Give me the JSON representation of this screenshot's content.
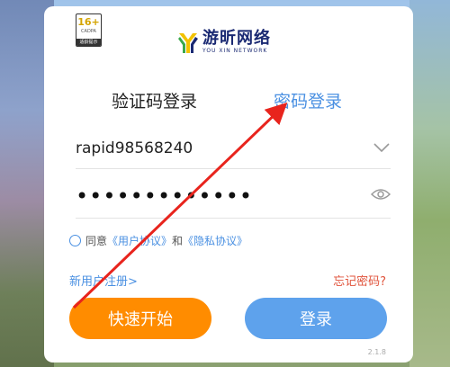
{
  "age_badge": {
    "age": "16+",
    "cadpa": "CADPA",
    "tip": "适龄提示"
  },
  "logo": {
    "name_cn": "游昕网络",
    "name_en": "YOU XIN NETWORK"
  },
  "tabs": {
    "sms_login": "验证码登录",
    "password_login": "密码登录"
  },
  "form": {
    "username": "rapid98568240",
    "password_masked": "•••••••••••••"
  },
  "agreement": {
    "prefix": "同意",
    "user_agreement": "《用户协议》",
    "and": "和",
    "privacy_policy": "《隐私协议》"
  },
  "links": {
    "register": "新用户注册>",
    "forgot": "忘记密码?"
  },
  "buttons": {
    "quick_start": "快速开始",
    "login": "登录"
  },
  "version": "2.1.8",
  "colors": {
    "accent_blue": "#4a90e2",
    "orange": "#ff8c00",
    "login_blue": "#5ea2ec",
    "forgot_red": "#e0533b",
    "arrow_red": "#e8241d"
  },
  "icons": {
    "chevron": "chevron-down-icon",
    "eye": "eye-icon",
    "logo": "youxin-logo-icon"
  }
}
